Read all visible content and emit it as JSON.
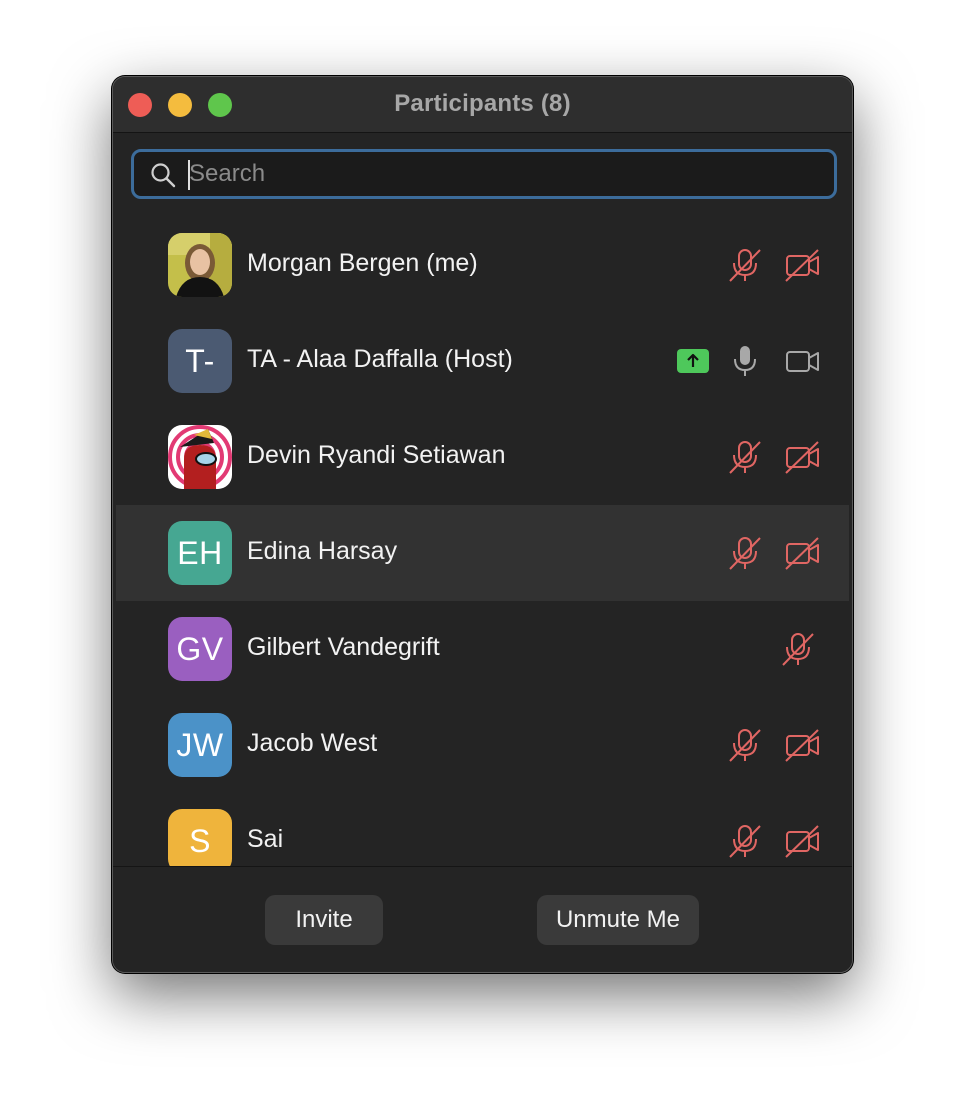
{
  "window": {
    "title": "Participants (8)"
  },
  "search": {
    "placeholder": "Search",
    "value": ""
  },
  "participants": [
    {
      "name": "Morgan Bergen (me)",
      "avatar": "photo",
      "mic": "muted",
      "video": "off"
    },
    {
      "name": "TA - Alaa Daffalla (Host)",
      "initials": "T-",
      "avatar_color": "#4b5a72",
      "sharing_screen": true,
      "mic": "on",
      "video": "on"
    },
    {
      "name": "Devin Ryandi Setiawan",
      "avatar": "image",
      "mic": "muted",
      "video": "off"
    },
    {
      "name": "Edina Harsay",
      "initials": "EH",
      "avatar_color": "#46a792",
      "mic": "muted",
      "video": "off",
      "selected": true
    },
    {
      "name": "Gilbert Vandegrift",
      "initials": "GV",
      "avatar_color": "#9a5fc0",
      "mic": "muted",
      "video": "none"
    },
    {
      "name": "Jacob West",
      "initials": "JW",
      "avatar_color": "#4b92c8",
      "mic": "muted",
      "video": "off"
    },
    {
      "name": "Sai",
      "initials": "S",
      "avatar_color": "#efb43c",
      "mic": "muted",
      "video": "off"
    }
  ],
  "footer": {
    "invite_label": "Invite",
    "unmute_label": "Unmute Me"
  },
  "colors": {
    "muted_icon": "#e06663",
    "active_icon": "#a8a8a8",
    "share_badge": "#4ec85b",
    "search_focus": "#3c6c9b"
  }
}
